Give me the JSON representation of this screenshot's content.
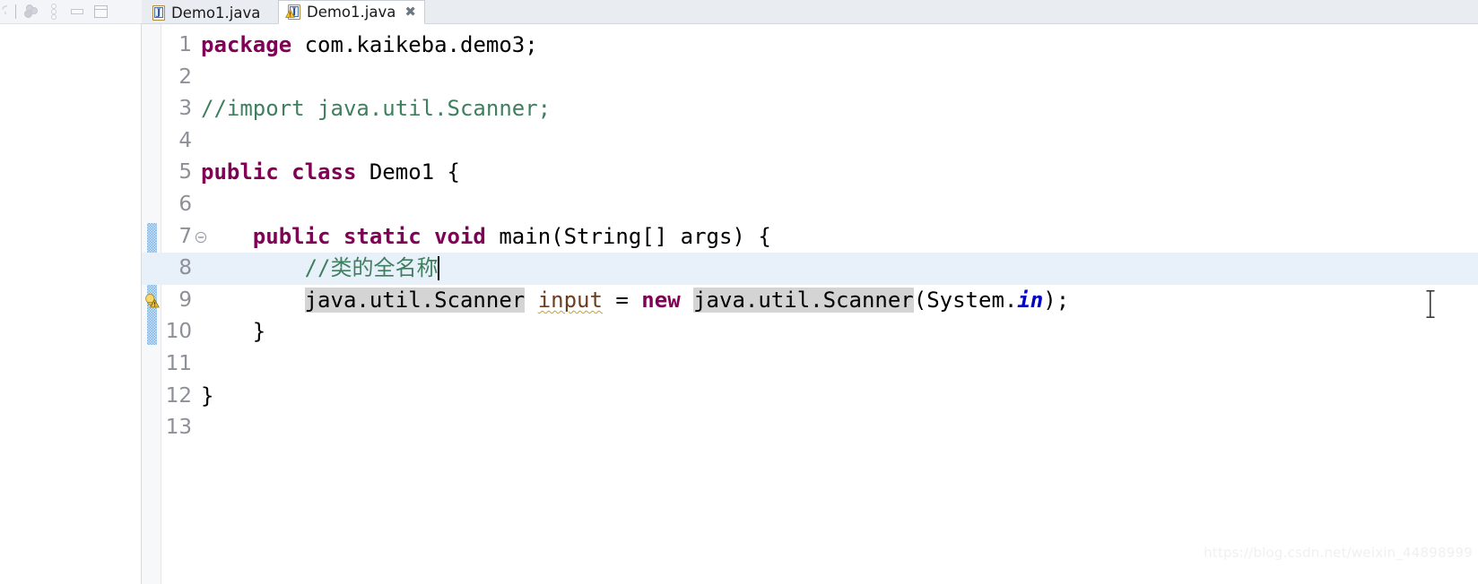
{
  "toolbar": {
    "items": [
      {
        "name": "perspective-partial-icon",
        "icon": "perspective-icon",
        "tooltip": ""
      },
      {
        "name": "link-with-editor-icon",
        "icon": "linked-dots-icon",
        "tooltip": "Link with Editor"
      },
      {
        "name": "view-menu-icon",
        "icon": "vertical-dots-icon",
        "tooltip": "View Menu"
      },
      {
        "name": "minimize-icon",
        "icon": "minimize-icon",
        "tooltip": "Minimize"
      },
      {
        "name": "maximize-icon",
        "icon": "maximize-icon",
        "tooltip": "Maximize"
      }
    ]
  },
  "tabs": [
    {
      "label": "Demo1.java",
      "active": false,
      "has_warning": false,
      "closable": false
    },
    {
      "label": "Demo1.java",
      "active": true,
      "has_warning": true,
      "closable": true,
      "close_glyph": "✖"
    }
  ],
  "editor": {
    "current_line": 8,
    "change_bar_lines": [
      7,
      8,
      9,
      10
    ],
    "folding_markers": [
      7
    ],
    "gutter_markers": [
      {
        "line": 9,
        "type": "quickfix-warning-icon"
      }
    ],
    "cursor_line": 8,
    "lines": [
      {
        "number": "1",
        "tokens": [
          {
            "text": "package",
            "style": "kw"
          },
          {
            "text": " com.kaikeba.demo3;",
            "style": "plain"
          }
        ]
      },
      {
        "number": "2",
        "tokens": []
      },
      {
        "number": "3",
        "tokens": [
          {
            "text": "//import java.util.Scanner;",
            "style": "cmt"
          }
        ]
      },
      {
        "number": "4",
        "tokens": []
      },
      {
        "number": "5",
        "tokens": [
          {
            "text": "public class",
            "style": "kw"
          },
          {
            "text": " Demo1 {",
            "style": "plain"
          }
        ]
      },
      {
        "number": "6",
        "tokens": []
      },
      {
        "number": "7",
        "tokens": [
          {
            "text": "    ",
            "style": "plain"
          },
          {
            "text": "public static void",
            "style": "kw"
          },
          {
            "text": " main(String[] args) {",
            "style": "plain"
          }
        ]
      },
      {
        "number": "8",
        "tokens": [
          {
            "text": "        ",
            "style": "plain"
          },
          {
            "text": "//类的全名称",
            "style": "cmt"
          },
          {
            "text": "",
            "style": "caret"
          }
        ]
      },
      {
        "number": "9",
        "tokens": [
          {
            "text": "        ",
            "style": "plain"
          },
          {
            "text": "java.util.Scanner",
            "style": "occ"
          },
          {
            "text": " ",
            "style": "plain"
          },
          {
            "text": "input",
            "style": "localv squig"
          },
          {
            "text": " = ",
            "style": "plain"
          },
          {
            "text": "new",
            "style": "kw"
          },
          {
            "text": " ",
            "style": "plain"
          },
          {
            "text": "java.util.Scanner",
            "style": "occ"
          },
          {
            "text": "(System.",
            "style": "plain"
          },
          {
            "text": "in",
            "style": "field"
          },
          {
            "text": ");",
            "style": "plain"
          }
        ]
      },
      {
        "number": "10",
        "tokens": [
          {
            "text": "    }",
            "style": "plain"
          }
        ]
      },
      {
        "number": "11",
        "tokens": []
      },
      {
        "number": "12",
        "tokens": [
          {
            "text": "}",
            "style": "plain"
          }
        ]
      },
      {
        "number": "13",
        "tokens": []
      }
    ]
  },
  "watermark": {
    "text": "https://blog.csdn.net/weixin_44898999"
  },
  "colors": {
    "keyword": "#7f0055",
    "comment": "#3f7f5f",
    "static_field": "#0000c0",
    "local_var": "#6a3e1f",
    "occurrence_highlight": "#d4d4d4",
    "current_line_highlight": "#e8f1fa",
    "warning_squiggle": "#c9a227",
    "change_bar": "#7db4e6",
    "tab_bar_bg": "#e9edf2"
  }
}
